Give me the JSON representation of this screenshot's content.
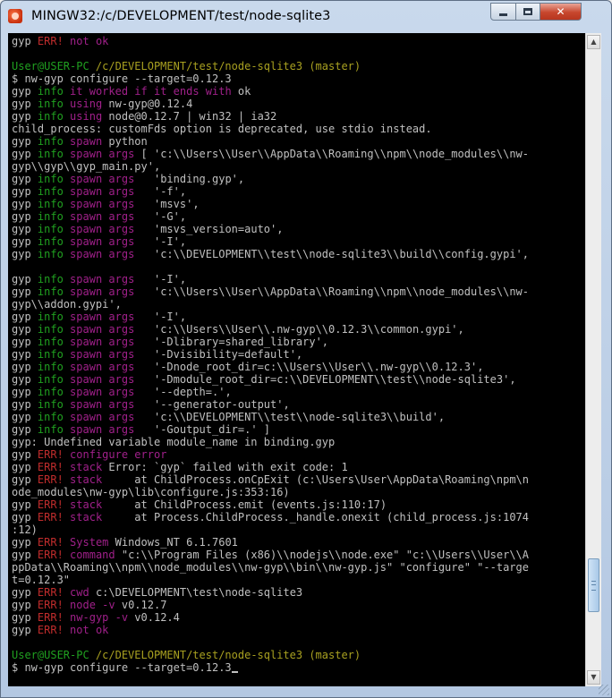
{
  "window": {
    "title": "MINGW32:/c/DEVELOPMENT/test/node-sqlite3",
    "icon": "mingw-app-icon",
    "buttons": {
      "minimize": "minimize-icon",
      "maximize": "maximize-icon",
      "close": "✕"
    }
  },
  "colors": {
    "background": "#000000",
    "default": "#c0c0c0",
    "red": "#c02c2c",
    "magenta": "#a0208a",
    "green": "#20a020",
    "olive": "#a8a020"
  },
  "terminal": {
    "lines": [
      [
        [
          "gyp ",
          "default"
        ],
        [
          "ERR!",
          "red"
        ],
        [
          " ",
          "default"
        ],
        [
          "not ok",
          "magenta"
        ]
      ],
      [],
      [
        [
          "User@USER-PC ",
          "green"
        ],
        [
          "/c/DEVELOPMENT/test/node-sqlite3 (master)",
          "olive"
        ]
      ],
      [
        [
          "$ nw-gyp configure --target=0.12.3",
          "default"
        ]
      ],
      [
        [
          "gyp ",
          "default"
        ],
        [
          "info",
          "green"
        ],
        [
          " ",
          "default"
        ],
        [
          "it worked if it ends with",
          "magenta"
        ],
        [
          " ok",
          "default"
        ]
      ],
      [
        [
          "gyp ",
          "default"
        ],
        [
          "info",
          "green"
        ],
        [
          " ",
          "default"
        ],
        [
          "using",
          "magenta"
        ],
        [
          " nw-gyp@0.12.4",
          "default"
        ]
      ],
      [
        [
          "gyp ",
          "default"
        ],
        [
          "info",
          "green"
        ],
        [
          " ",
          "default"
        ],
        [
          "using",
          "magenta"
        ],
        [
          " node@0.12.7 | win32 | ia32",
          "default"
        ]
      ],
      [
        [
          "child_process: customFds option is deprecated, use stdio instead.",
          "default"
        ]
      ],
      [
        [
          "gyp ",
          "default"
        ],
        [
          "info",
          "green"
        ],
        [
          " ",
          "default"
        ],
        [
          "spawn",
          "magenta"
        ],
        [
          " python",
          "default"
        ]
      ],
      [
        [
          "gyp ",
          "default"
        ],
        [
          "info",
          "green"
        ],
        [
          " ",
          "default"
        ],
        [
          "spawn args",
          "magenta"
        ],
        [
          " [ 'c:\\\\Users\\\\User\\\\AppData\\\\Roaming\\\\npm\\\\node_modules\\\\nw-",
          "default"
        ]
      ],
      [
        [
          "gyp\\\\gyp\\\\gyp_main.py',",
          "default"
        ]
      ],
      [
        [
          "gyp ",
          "default"
        ],
        [
          "info",
          "green"
        ],
        [
          " ",
          "default"
        ],
        [
          "spawn args",
          "magenta"
        ],
        [
          "   'binding.gyp',",
          "default"
        ]
      ],
      [
        [
          "gyp ",
          "default"
        ],
        [
          "info",
          "green"
        ],
        [
          " ",
          "default"
        ],
        [
          "spawn args",
          "magenta"
        ],
        [
          "   '-f',",
          "default"
        ]
      ],
      [
        [
          "gyp ",
          "default"
        ],
        [
          "info",
          "green"
        ],
        [
          " ",
          "default"
        ],
        [
          "spawn args",
          "magenta"
        ],
        [
          "   'msvs',",
          "default"
        ]
      ],
      [
        [
          "gyp ",
          "default"
        ],
        [
          "info",
          "green"
        ],
        [
          " ",
          "default"
        ],
        [
          "spawn args",
          "magenta"
        ],
        [
          "   '-G',",
          "default"
        ]
      ],
      [
        [
          "gyp ",
          "default"
        ],
        [
          "info",
          "green"
        ],
        [
          " ",
          "default"
        ],
        [
          "spawn args",
          "magenta"
        ],
        [
          "   'msvs_version=auto',",
          "default"
        ]
      ],
      [
        [
          "gyp ",
          "default"
        ],
        [
          "info",
          "green"
        ],
        [
          " ",
          "default"
        ],
        [
          "spawn args",
          "magenta"
        ],
        [
          "   '-I',",
          "default"
        ]
      ],
      [
        [
          "gyp ",
          "default"
        ],
        [
          "info",
          "green"
        ],
        [
          " ",
          "default"
        ],
        [
          "spawn args",
          "magenta"
        ],
        [
          "   'c:\\\\DEVELOPMENT\\\\test\\\\node-sqlite3\\\\build\\\\config.gypi',",
          "default"
        ]
      ],
      [],
      [
        [
          "gyp ",
          "default"
        ],
        [
          "info",
          "green"
        ],
        [
          " ",
          "default"
        ],
        [
          "spawn args",
          "magenta"
        ],
        [
          "   '-I',",
          "default"
        ]
      ],
      [
        [
          "gyp ",
          "default"
        ],
        [
          "info",
          "green"
        ],
        [
          " ",
          "default"
        ],
        [
          "spawn args",
          "magenta"
        ],
        [
          "   'c:\\\\Users\\\\User\\\\AppData\\\\Roaming\\\\npm\\\\node_modules\\\\nw-",
          "default"
        ]
      ],
      [
        [
          "gyp\\\\addon.gypi',",
          "default"
        ]
      ],
      [
        [
          "gyp ",
          "default"
        ],
        [
          "info",
          "green"
        ],
        [
          " ",
          "default"
        ],
        [
          "spawn args",
          "magenta"
        ],
        [
          "   '-I',",
          "default"
        ]
      ],
      [
        [
          "gyp ",
          "default"
        ],
        [
          "info",
          "green"
        ],
        [
          " ",
          "default"
        ],
        [
          "spawn args",
          "magenta"
        ],
        [
          "   'c:\\\\Users\\\\User\\\\.nw-gyp\\\\0.12.3\\\\common.gypi',",
          "default"
        ]
      ],
      [
        [
          "gyp ",
          "default"
        ],
        [
          "info",
          "green"
        ],
        [
          " ",
          "default"
        ],
        [
          "spawn args",
          "magenta"
        ],
        [
          "   '-Dlibrary=shared_library',",
          "default"
        ]
      ],
      [
        [
          "gyp ",
          "default"
        ],
        [
          "info",
          "green"
        ],
        [
          " ",
          "default"
        ],
        [
          "spawn args",
          "magenta"
        ],
        [
          "   '-Dvisibility=default',",
          "default"
        ]
      ],
      [
        [
          "gyp ",
          "default"
        ],
        [
          "info",
          "green"
        ],
        [
          " ",
          "default"
        ],
        [
          "spawn args",
          "magenta"
        ],
        [
          "   '-Dnode_root_dir=c:\\\\Users\\\\User\\\\.nw-gyp\\\\0.12.3',",
          "default"
        ]
      ],
      [
        [
          "gyp ",
          "default"
        ],
        [
          "info",
          "green"
        ],
        [
          " ",
          "default"
        ],
        [
          "spawn args",
          "magenta"
        ],
        [
          "   '-Dmodule_root_dir=c:\\\\DEVELOPMENT\\\\test\\\\node-sqlite3',",
          "default"
        ]
      ],
      [
        [
          "gyp ",
          "default"
        ],
        [
          "info",
          "green"
        ],
        [
          " ",
          "default"
        ],
        [
          "spawn args",
          "magenta"
        ],
        [
          "   '--depth=.',",
          "default"
        ]
      ],
      [
        [
          "gyp ",
          "default"
        ],
        [
          "info",
          "green"
        ],
        [
          " ",
          "default"
        ],
        [
          "spawn args",
          "magenta"
        ],
        [
          "   '--generator-output',",
          "default"
        ]
      ],
      [
        [
          "gyp ",
          "default"
        ],
        [
          "info",
          "green"
        ],
        [
          " ",
          "default"
        ],
        [
          "spawn args",
          "magenta"
        ],
        [
          "   'c:\\\\DEVELOPMENT\\\\test\\\\node-sqlite3\\\\build',",
          "default"
        ]
      ],
      [
        [
          "gyp ",
          "default"
        ],
        [
          "info",
          "green"
        ],
        [
          " ",
          "default"
        ],
        [
          "spawn args",
          "magenta"
        ],
        [
          "   '-Goutput_dir=.' ]",
          "default"
        ]
      ],
      [
        [
          "gyp: Undefined variable module_name in binding.gyp",
          "default"
        ]
      ],
      [
        [
          "gyp ",
          "default"
        ],
        [
          "ERR!",
          "red"
        ],
        [
          " ",
          "default"
        ],
        [
          "configure error",
          "magenta"
        ]
      ],
      [
        [
          "gyp ",
          "default"
        ],
        [
          "ERR!",
          "red"
        ],
        [
          " ",
          "default"
        ],
        [
          "stack",
          "magenta"
        ],
        [
          " Error: `gyp` failed with exit code: 1",
          "default"
        ]
      ],
      [
        [
          "gyp ",
          "default"
        ],
        [
          "ERR!",
          "red"
        ],
        [
          " ",
          "default"
        ],
        [
          "stack",
          "magenta"
        ],
        [
          "     at ChildProcess.onCpExit (c:\\Users\\User\\AppData\\Roaming\\npm\\n",
          "default"
        ]
      ],
      [
        [
          "ode_modules\\nw-gyp\\lib\\configure.js:353:16)",
          "default"
        ]
      ],
      [
        [
          "gyp ",
          "default"
        ],
        [
          "ERR!",
          "red"
        ],
        [
          " ",
          "default"
        ],
        [
          "stack",
          "magenta"
        ],
        [
          "     at ChildProcess.emit (events.js:110:17)",
          "default"
        ]
      ],
      [
        [
          "gyp ",
          "default"
        ],
        [
          "ERR!",
          "red"
        ],
        [
          " ",
          "default"
        ],
        [
          "stack",
          "magenta"
        ],
        [
          "     at Process.ChildProcess._handle.onexit (child_process.js:1074",
          "default"
        ]
      ],
      [
        [
          ":12)",
          "default"
        ]
      ],
      [
        [
          "gyp ",
          "default"
        ],
        [
          "ERR!",
          "red"
        ],
        [
          " ",
          "default"
        ],
        [
          "System",
          "magenta"
        ],
        [
          " Windows_NT 6.1.7601",
          "default"
        ]
      ],
      [
        [
          "gyp ",
          "default"
        ],
        [
          "ERR!",
          "red"
        ],
        [
          " ",
          "default"
        ],
        [
          "command",
          "magenta"
        ],
        [
          " \"c:\\\\Program Files (x86)\\\\nodejs\\\\node.exe\" \"c:\\\\Users\\\\User\\\\A",
          "default"
        ]
      ],
      [
        [
          "ppData\\\\Roaming\\\\npm\\\\node_modules\\\\nw-gyp\\\\bin\\\\nw-gyp.js\" \"configure\" \"--targe",
          "default"
        ]
      ],
      [
        [
          "t=0.12.3\"",
          "default"
        ]
      ],
      [
        [
          "gyp ",
          "default"
        ],
        [
          "ERR!",
          "red"
        ],
        [
          " ",
          "default"
        ],
        [
          "cwd",
          "magenta"
        ],
        [
          " c:\\DEVELOPMENT\\test\\node-sqlite3",
          "default"
        ]
      ],
      [
        [
          "gyp ",
          "default"
        ],
        [
          "ERR!",
          "red"
        ],
        [
          " ",
          "default"
        ],
        [
          "node -v",
          "magenta"
        ],
        [
          " v0.12.7",
          "default"
        ]
      ],
      [
        [
          "gyp ",
          "default"
        ],
        [
          "ERR!",
          "red"
        ],
        [
          " ",
          "default"
        ],
        [
          "nw-gyp -v",
          "magenta"
        ],
        [
          " v0.12.4",
          "default"
        ]
      ],
      [
        [
          "gyp ",
          "default"
        ],
        [
          "ERR!",
          "red"
        ],
        [
          " ",
          "default"
        ],
        [
          "not ok",
          "magenta"
        ]
      ],
      [],
      [
        [
          "User@USER-PC ",
          "green"
        ],
        [
          "/c/DEVELOPMENT/test/node-sqlite3 (master)",
          "olive"
        ]
      ],
      [
        [
          "$ nw-gyp configure --target=0.12.3",
          "default"
        ]
      ]
    ]
  },
  "scrollbar": {
    "position": 0.9,
    "up_icon": "▲",
    "down_icon": "▼"
  }
}
